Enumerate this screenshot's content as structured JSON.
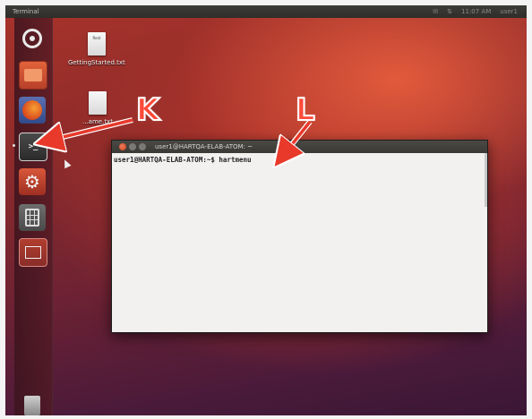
{
  "topbar": {
    "title": "Terminal",
    "indicators": [
      "✉",
      "⇅",
      "11:07 AM",
      "user1"
    ]
  },
  "launcher": {
    "items": [
      {
        "name": "Dash Home",
        "icon": "ubuntu-logo-icon"
      },
      {
        "name": "Files",
        "icon": "folder-icon"
      },
      {
        "name": "Firefox",
        "icon": "firefox-icon"
      },
      {
        "name": "Terminal",
        "icon": "terminal-icon",
        "prompt": ">_"
      },
      {
        "name": "System Settings",
        "icon": "gear-icon",
        "glyph": "⚙"
      },
      {
        "name": "Calculator",
        "icon": "calculator-icon"
      },
      {
        "name": "Window",
        "icon": "window-icon"
      },
      {
        "name": "Trash",
        "icon": "trash-icon"
      }
    ]
  },
  "desktop": {
    "icons": [
      {
        "name": "GettingStarted.txt",
        "page_text": "Rest"
      },
      {
        "name": "...ame.txt",
        "page_text": ""
      }
    ]
  },
  "terminal": {
    "title": "user1@HARTQA-ELAB-ATOM: ~",
    "prompt": "user1@HARTQA-ELAB-ATOM:~$ hartmenu"
  },
  "annotations": {
    "k_label": "K",
    "l_label": "L",
    "color": "#e8392b"
  }
}
